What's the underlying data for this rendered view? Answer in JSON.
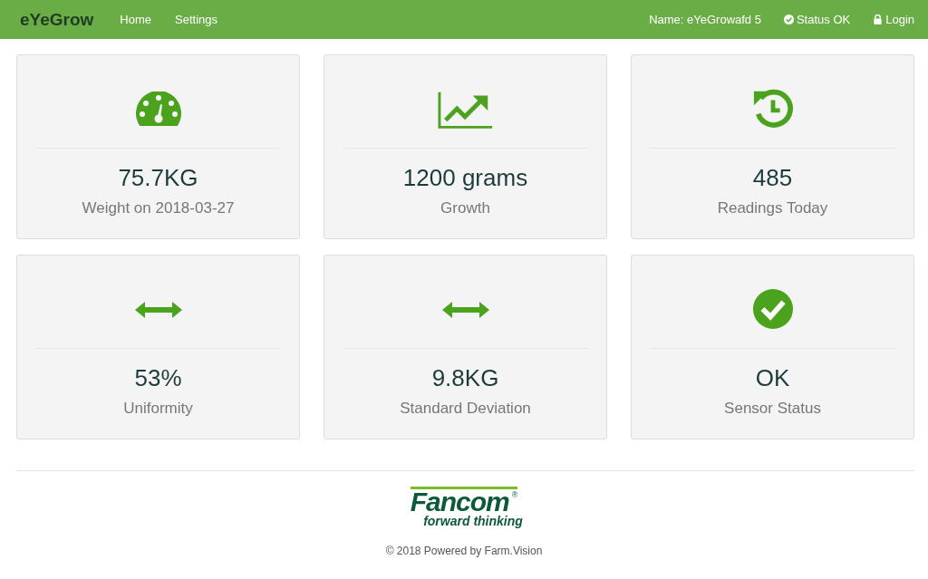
{
  "navbar": {
    "brand": "eYeGrow",
    "links": [
      {
        "label": "Home"
      },
      {
        "label": "Settings"
      }
    ],
    "right": [
      {
        "kind": "text",
        "label": "Name: eYeGrowafd 5"
      },
      {
        "kind": "status",
        "label": "Status OK"
      },
      {
        "kind": "login",
        "label": "Login"
      }
    ]
  },
  "cards": [
    {
      "kind": "gauge",
      "value": "75.7KG",
      "label": "Weight on 2018-03-27"
    },
    {
      "kind": "chart",
      "value": "1200 grams",
      "label": "Growth"
    },
    {
      "kind": "history",
      "value": "485",
      "label": "Readings Today"
    },
    {
      "kind": "arrows",
      "value": "53%",
      "label": "Uniformity"
    },
    {
      "kind": "arrows",
      "value": "9.8KG",
      "label": "Standard Deviation"
    },
    {
      "kind": "check",
      "value": "OK",
      "label": "Sensor Status"
    }
  ],
  "footer": {
    "logo": {
      "name": "Fancom",
      "mark": "®",
      "tagline": "forward thinking"
    },
    "copyright": "© 2018 Powered by ",
    "link": "Farm.Vision"
  }
}
